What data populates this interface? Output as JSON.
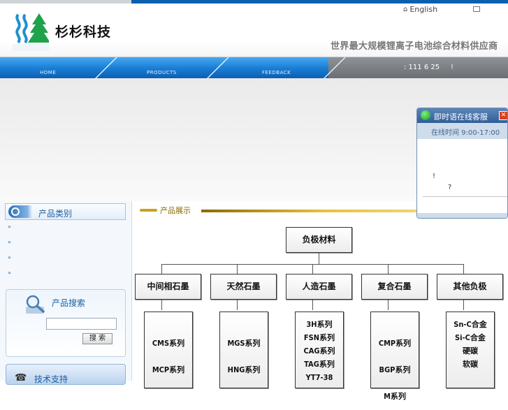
{
  "header": {
    "logo_text": "杉杉科技",
    "lang_link": "English",
    "slogan": "世界最大规模锂离子电池综合材料供应商"
  },
  "nav": {
    "items": [
      "HOME",
      "PRODUCTS",
      "FEEDBACK"
    ],
    "notice": ": 111 6 25",
    "notice_mark": "!"
  },
  "sidebar": {
    "categories_title": "产品类别",
    "search_title": "产品搜索",
    "search_button": "搜 索",
    "search_value": "",
    "tech_title": "技术支持"
  },
  "main": {
    "section_title": "产品展示",
    "tree": {
      "root": "负极材料",
      "branches": [
        {
          "label": "中间相石墨",
          "items": [
            "CMS系列",
            "MCP系列"
          ]
        },
        {
          "label": "天然石墨",
          "items": [
            "MGS系列",
            "HNG系列"
          ]
        },
        {
          "label": "人造石墨",
          "items": [
            "3H系列",
            "FSN系列",
            "CAG系列",
            "TAG系列",
            "YT7-38"
          ]
        },
        {
          "label": "复合石墨",
          "items": [
            "CMP系列",
            "BGP系列",
            "M系列"
          ]
        },
        {
          "label": "其他负极",
          "items": [
            "Sn-C合金",
            "Si-C合金",
            "硬碳",
            "软碳"
          ]
        }
      ]
    }
  },
  "chat_popup": {
    "title": "即时语在线客服",
    "hours": "在线时间 9:00-17:00",
    "msg1": "!",
    "msg2": "?"
  },
  "colors": {
    "nav_blue": "#1a7fd6",
    "accent_gold": "#c9a21a",
    "link_blue": "#1c5fa5"
  },
  "icons": [
    "home-icon",
    "mail-icon",
    "target-icon",
    "magnifier-icon",
    "phone-icon",
    "chat-icon",
    "close-icon",
    "bullet-icon"
  ]
}
